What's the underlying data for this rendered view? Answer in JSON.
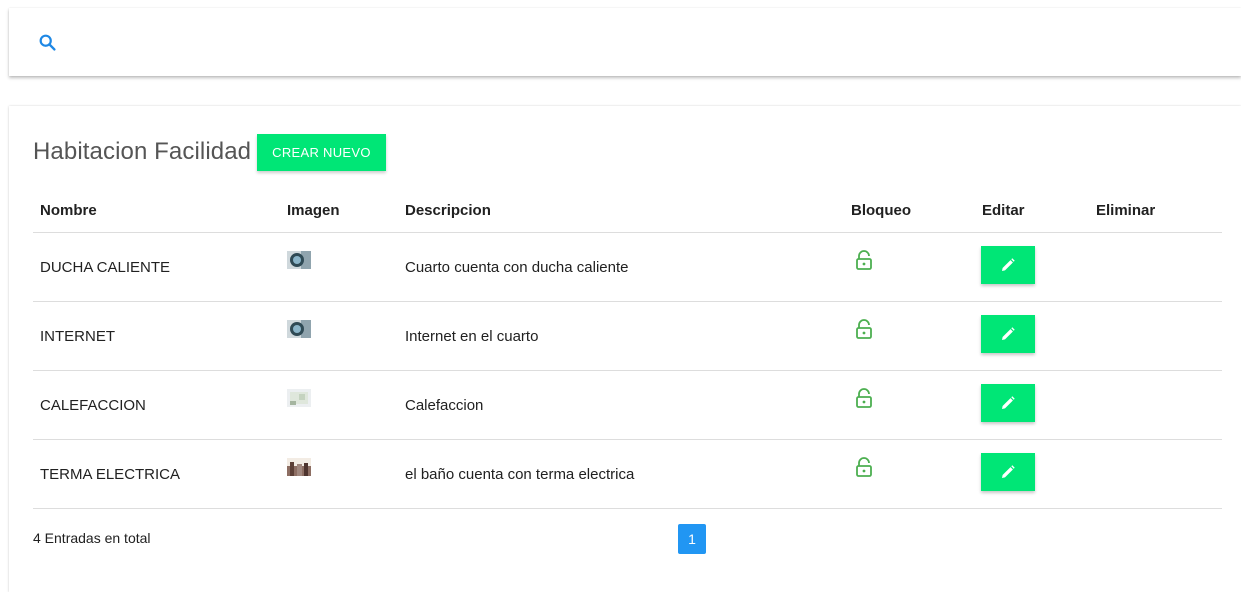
{
  "search": {
    "icon": "search-icon",
    "icon_color": "#1e88e5"
  },
  "panel": {
    "title": "Habitacion Facilidad",
    "create_button": "CREAR NUEVO"
  },
  "table": {
    "columns": [
      "Nombre",
      "Imagen",
      "Descripcion",
      "Bloqueo",
      "Editar",
      "Eliminar"
    ],
    "rows": [
      {
        "nombre": "DUCHA CALIENTE",
        "imagen": "thumbnail-photo",
        "descripcion": "Cuarto cuenta con ducha caliente",
        "bloqueo": "unlock-icon",
        "editar": "edit-icon"
      },
      {
        "nombre": "INTERNET",
        "imagen": "thumbnail-photo",
        "descripcion": "Internet en el cuarto",
        "bloqueo": "unlock-icon",
        "editar": "edit-icon"
      },
      {
        "nombre": "CALEFACCION",
        "imagen": "thumbnail-photo",
        "descripcion": "Calefaccion",
        "bloqueo": "unlock-icon",
        "editar": "edit-icon"
      },
      {
        "nombre": "TERMA ELECTRICA",
        "imagen": "thumbnail-photo",
        "descripcion": "el baño cuenta con terma electrica",
        "bloqueo": "unlock-icon",
        "editar": "edit-icon"
      }
    ]
  },
  "footer": {
    "total_text": "4 Entradas en total",
    "current_page": "1"
  },
  "colors": {
    "accent_green": "#00e676",
    "lock_green": "#4caf50",
    "page_blue": "#2196f3"
  }
}
